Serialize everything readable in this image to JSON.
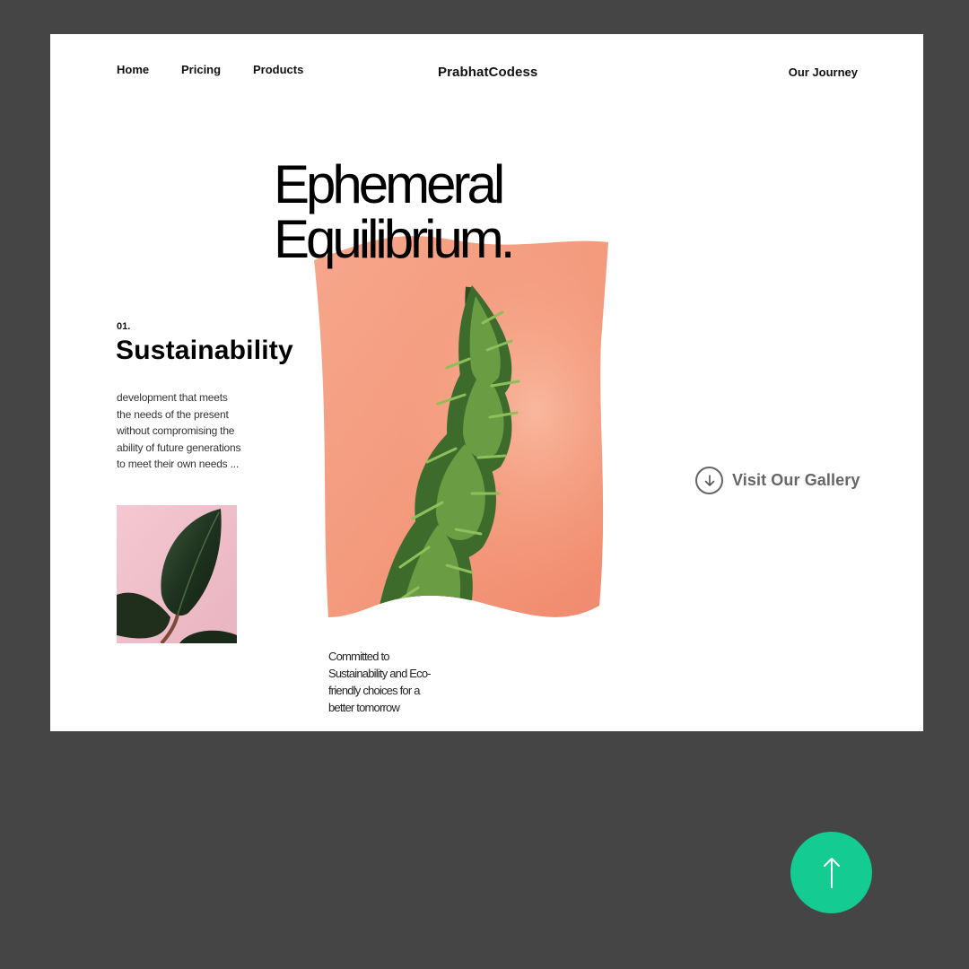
{
  "nav": {
    "home": "Home",
    "pricing": "Pricing",
    "products": "Products",
    "brand": "PrabhatCodess",
    "journey": "Our Journey"
  },
  "hero": {
    "line1": "Ephemeral",
    "line2": "Equilibrium."
  },
  "section": {
    "number": "01.",
    "heading": "Sustainability",
    "description": "development that meets the needs of the present without compromising the ability of future generations to meet their own needs ..."
  },
  "caption": "Committed to Sustainability and Eco-friendly choices for a better tomorrow",
  "gallery": {
    "label": "Visit Our Gallery",
    "icon": "arrow-down-circle-icon"
  },
  "scroll_top": {
    "icon": "arrow-up-icon"
  },
  "colors": {
    "background": "#454545",
    "card": "#ffffff",
    "accent": "#14cc92",
    "peach": "#f49c80",
    "pink": "#efc3cd"
  }
}
